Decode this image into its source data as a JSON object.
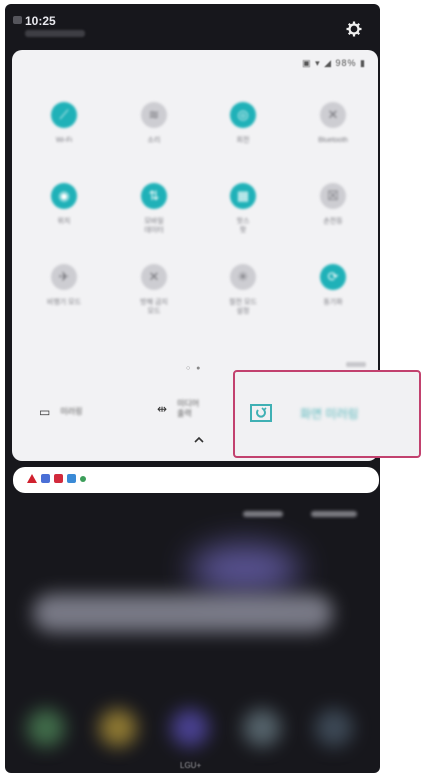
{
  "status_bar": {
    "time": "10:25",
    "date": "",
    "icons_text": "▣ ▾ ◢ 98% ▮"
  },
  "tiles": [
    {
      "label": "Wi-Fi",
      "active": true,
      "icon": "wifi-icon",
      "glyph": "⟋"
    },
    {
      "label": "소리",
      "active": false,
      "icon": "sound-icon",
      "glyph": "≋"
    },
    {
      "label": "회전",
      "active": true,
      "icon": "rotate-icon",
      "glyph": "◎"
    },
    {
      "label": "Bluetooth",
      "active": false,
      "icon": "bluetooth-icon",
      "glyph": "✕"
    },
    {
      "label": "위치",
      "active": true,
      "icon": "location-icon",
      "glyph": "◉"
    },
    {
      "label": "모바일\n데이터",
      "active": true,
      "icon": "data-icon",
      "glyph": "⇅"
    },
    {
      "label": "핫스\n팟",
      "active": true,
      "icon": "hotspot-icon",
      "glyph": "▦"
    },
    {
      "label": "손전등",
      "active": false,
      "icon": "flashlight-icon",
      "glyph": "☒"
    },
    {
      "label": "비행기 모드",
      "active": false,
      "icon": "airplane-icon",
      "glyph": "✈"
    },
    {
      "label": "방해 금지\n모드",
      "active": false,
      "icon": "dnd-icon",
      "glyph": "✕"
    },
    {
      "label": "절전 모드\n설정",
      "active": false,
      "icon": "battery-saver-icon",
      "glyph": "✳"
    },
    {
      "label": "동기화",
      "active": true,
      "icon": "sync-icon",
      "glyph": "⟳"
    }
  ],
  "page_indicator": "○ ●",
  "bottom_items": [
    {
      "icon": "device-icon",
      "glyph": "▭",
      "label": "미러링"
    },
    {
      "icon": "media-output-icon",
      "glyph": "⇹",
      "label": "미디어\n출력"
    }
  ],
  "callout": {
    "label": "화면 미러링",
    "icon": "screen-mirroring-icon"
  },
  "notification_bar": {
    "icons": [
      {
        "name": "warning-icon",
        "color": "#d0202e"
      },
      {
        "name": "app-icon",
        "color": "#4a6fd6"
      },
      {
        "name": "app-icon",
        "color": "#d22a3c"
      },
      {
        "name": "arrow-icon",
        "color": "#3a8ad6"
      },
      {
        "name": "dot-icon",
        "color": "#3c9e5a"
      }
    ]
  },
  "home": {
    "carrier": "LGU+"
  },
  "colors": {
    "accent": "#1fb1b8",
    "highlight_border": "#c2416e",
    "panel": "#f2f2f4",
    "background": "#17171c"
  }
}
